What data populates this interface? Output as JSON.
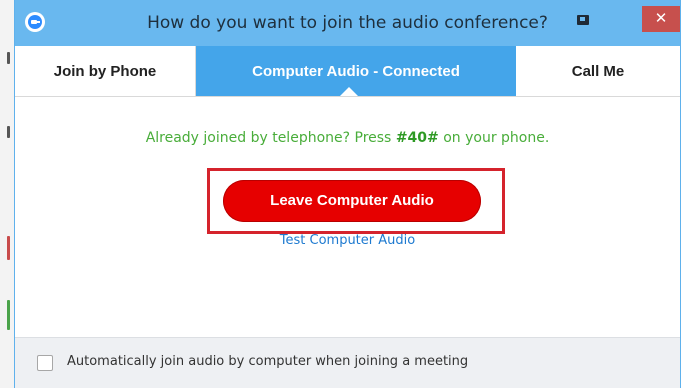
{
  "window": {
    "title": "How do you want to join the audio conference?",
    "close_label": "✕"
  },
  "tabs": [
    {
      "label": "Join by Phone",
      "active": false
    },
    {
      "label": "Computer Audio - Connected",
      "active": true
    },
    {
      "label": "Call Me",
      "active": false
    }
  ],
  "main": {
    "info_prefix": "Already joined by telephone? Press ",
    "info_code": "#40#",
    "info_suffix": " on your phone.",
    "leave_button_label": "Leave Computer Audio",
    "test_link_label": "Test Computer Audio"
  },
  "footer": {
    "auto_join_label": "Automatically join audio by computer when joining a meeting",
    "auto_join_checked": false
  },
  "colors": {
    "titlebar": "#69b8ef",
    "active_tab": "#44a5ea",
    "leave_button": "#e60000",
    "highlight_border": "#d5232c",
    "info_text": "#49ad3a",
    "link": "#1e7ad0",
    "close_button": "#c7504d"
  }
}
